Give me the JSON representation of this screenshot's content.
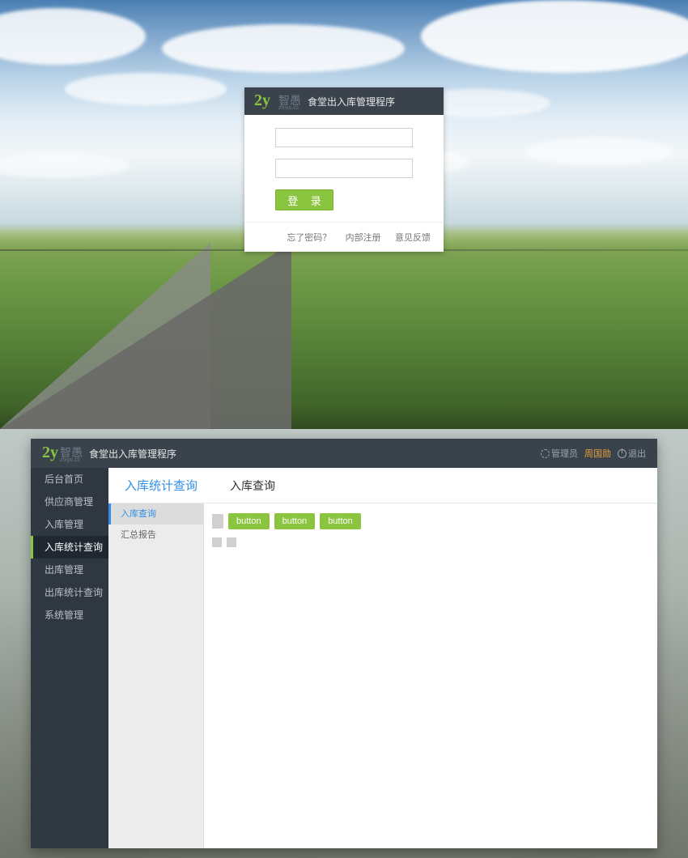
{
  "logo": {
    "mark": "2y",
    "brand": "智愚",
    "brand_pinyin": "zhiyu.cc"
  },
  "app_title": "食堂出入库管理程序",
  "login": {
    "button": "登 录",
    "links": {
      "forgot": "忘了密码？",
      "register": "内部注册",
      "feedback": "意见反馈"
    }
  },
  "admin": {
    "head": {
      "admin_link": "管理员",
      "user": "周国勋",
      "logout": "退出"
    },
    "sidebar": [
      "后台首页",
      "供应商管理",
      "入库管理",
      "入库统计查询",
      "出库管理",
      "出库统计查询",
      "系统管理"
    ],
    "sidebar_active_index": 3,
    "crumb": {
      "main": "入库统计查询",
      "sub": "入库查询"
    },
    "subnav": [
      "入库查询",
      "汇总报告"
    ],
    "subnav_active_index": 0,
    "buttons": [
      "button",
      "button",
      "button"
    ]
  }
}
